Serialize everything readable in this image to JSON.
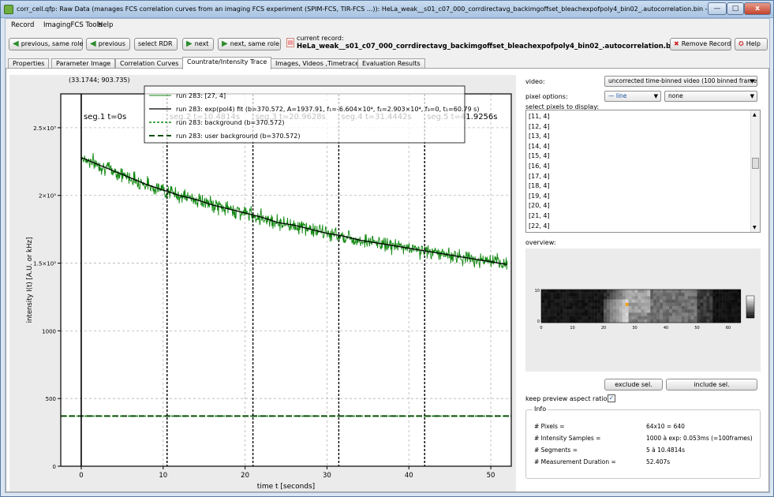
{
  "window": {
    "title": "corr_cell.qfp: Raw Data (manages FCS correlation curves from an imaging FCS experiment (SPIM-FCS, TIR-FCS ...)): HeLa_weak__s01_c07_000_corrdirectavg_backimgoffset_bleachexpofpoly4_bin02_.autocorrelation.bin - ...",
    "min": "—",
    "max": "□",
    "close": "x"
  },
  "menu": [
    "Record",
    "ImagingFCS Tools",
    "Help"
  ],
  "toolbar": {
    "prev_same_role": "previous, same role",
    "previous": "previous",
    "select_rdr": "select RDR",
    "next": "next",
    "next_same_role": "next, same role",
    "current_record_label": "current record:",
    "current_record": "HeLa_weak__s01_c07_000_corrdirectavg_backimgoffset_bleachexpofpoly4_bin02_.autocorrelation.bin - ACF",
    "remove_record": "Remove Record",
    "help": "Help"
  },
  "tabs": [
    "Properties",
    "Parameter Image",
    "Correlation Curves",
    "Countrate/Intensity Trace",
    "Images, Videos ,Timetrace",
    "Evaluation Results"
  ],
  "active_tab": 3,
  "plot": {
    "coord_readout": "(33.1744; 903.735)"
  },
  "chart_data": {
    "type": "line",
    "xlabel": "time t [seconds]",
    "ylabel": "intensity I(t) [A.U. or kHz]",
    "xlim": [
      -2.5,
      52.5
    ],
    "ylim": [
      0,
      2750
    ],
    "xticks": [
      0,
      10,
      20,
      30,
      40,
      50
    ],
    "yticks": [
      {
        "v": 0,
        "label": "0"
      },
      {
        "v": 500,
        "label": "500"
      },
      {
        "v": 1000,
        "label": "1000"
      },
      {
        "v": 1500,
        "label": "1.5×10³"
      },
      {
        "v": 2000,
        "label": "2×10³"
      },
      {
        "v": 2500,
        "label": "2.5×10³"
      }
    ],
    "grid": true,
    "series": [
      {
        "name": "run 283: [27, 4]",
        "kind": "trace",
        "color": "#118811",
        "x": [
          0,
          2,
          4,
          6,
          8,
          10,
          12,
          14,
          16,
          18,
          20,
          22,
          24,
          26,
          28,
          30,
          32,
          34,
          36,
          38,
          40,
          42,
          44,
          46,
          48,
          50,
          52
        ],
        "y": [
          2280,
          2230,
          2180,
          2130,
          2080,
          2040,
          2000,
          1970,
          1930,
          1900,
          1870,
          1840,
          1800,
          1780,
          1750,
          1720,
          1700,
          1670,
          1650,
          1630,
          1610,
          1590,
          1570,
          1550,
          1530,
          1510,
          1490
        ]
      },
      {
        "name": "run 283: exp(pol4) fit (b=370.572, A=1937.91, f₁=-6.604×10⁴, f₂=2.903×10⁴, f₃=0, t₁=60.79 s)",
        "kind": "fit",
        "color": "#000000",
        "x": [
          0,
          2,
          4,
          6,
          8,
          10,
          12,
          14,
          16,
          18,
          20,
          22,
          24,
          26,
          28,
          30,
          32,
          34,
          36,
          38,
          40,
          42,
          44,
          46,
          48,
          50,
          52
        ],
        "y": [
          2280,
          2230,
          2180,
          2130,
          2080,
          2040,
          2000,
          1970,
          1930,
          1900,
          1870,
          1840,
          1800,
          1780,
          1750,
          1720,
          1700,
          1670,
          1650,
          1630,
          1610,
          1590,
          1570,
          1550,
          1530,
          1510,
          1490
        ]
      },
      {
        "name": "run 283: background (b=370.572)",
        "kind": "background",
        "color": "#118811",
        "x": [
          -2.5,
          52.5
        ],
        "y": [
          370.572,
          370.572
        ]
      },
      {
        "name": "run 283: user background (b=370.572)",
        "kind": "user_background",
        "color": "#0d4d0d",
        "x": [
          -2.5,
          52.5
        ],
        "y": [
          370.572,
          370.572
        ]
      }
    ],
    "segments": [
      {
        "t": 0,
        "label": "seg.1 t=0s"
      },
      {
        "t": 10.4814,
        "label": "seg.2 t=10.4814s"
      },
      {
        "t": 20.9628,
        "label": "seg.3 t=20.9628s"
      },
      {
        "t": 31.4442,
        "label": "seg.4 t=31.4442s"
      },
      {
        "t": 41.9256,
        "label": "seg.5 t=41.9256s"
      }
    ],
    "legend_position": "top-right"
  },
  "right": {
    "video_label": "video:",
    "video_value": "uncorrected time-binned video (100 binned frame",
    "pixel_options_label": "pixel options:",
    "line_style": "— line",
    "pixel_option": "none",
    "select_pixels_label": "select pixels to display:",
    "pixels": [
      "[11, 4]",
      "[12, 4]",
      "[13, 4]",
      "[14, 4]",
      "[15, 4]",
      "[16, 4]",
      "[17, 4]",
      "[18, 4]",
      "[19, 4]",
      "[20, 4]",
      "[21, 4]",
      "[22, 4]"
    ],
    "overview_label": "overview:",
    "overview_xticks": [
      "0",
      "10",
      "20",
      "30",
      "40",
      "50",
      "60"
    ],
    "overview_yticks": [
      "10",
      "0"
    ],
    "exclude_btn": "exclude sel.",
    "include_btn": "include sel.",
    "keep_aspect_label": "keep preview aspect ratio:",
    "keep_aspect_checked": true,
    "info_title": "Info",
    "info": [
      [
        "# Pixels =",
        "64x10 = 640"
      ],
      [
        "# Intensity Samples =",
        "1000 à exp: 0.053ms (=100frames)"
      ],
      [
        "# Segments =",
        "5 à 10.4814s"
      ],
      [
        "# Measurement Duration =",
        "52.407s"
      ]
    ]
  }
}
